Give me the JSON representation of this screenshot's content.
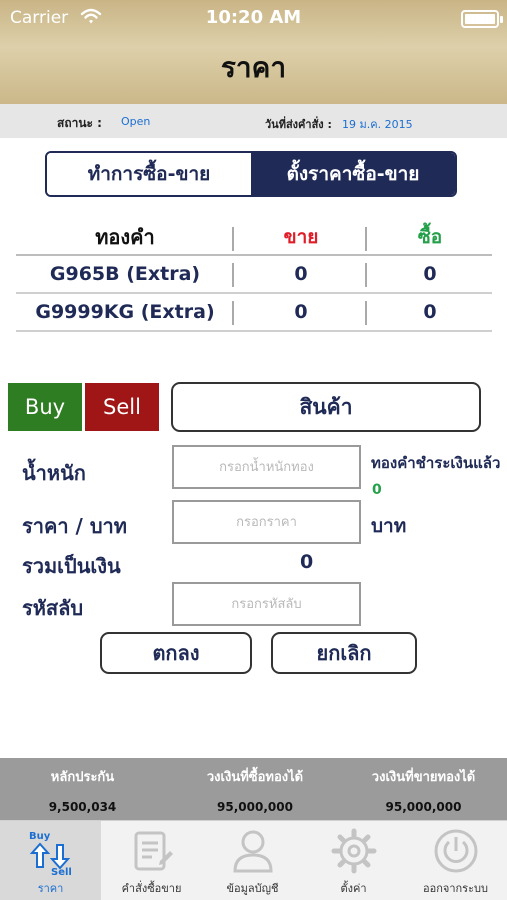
{
  "status_bar": {
    "carrier": "Carrier",
    "time": "10:20 AM"
  },
  "header": {
    "title": "ราคา"
  },
  "info": {
    "status_label": "สถานะ :",
    "status_value": "Open",
    "order_date_label": "วันที่ส่งคำสั่ง :",
    "order_date_value": "19 ม.ค. 2015"
  },
  "segment": {
    "trade_label": "ทำการซื้อ-ขาย",
    "set_price_label": "ตั้งราคาซื้อ-ขาย",
    "active": "set_price"
  },
  "price_table": {
    "headers": {
      "gold": "ทองคำ",
      "sell": "ขาย",
      "buy": "ซื้อ"
    },
    "rows": [
      {
        "product": "G965B (Extra)",
        "sell": "0",
        "buy": "0"
      },
      {
        "product": "G9999KG (Extra)",
        "sell": "0",
        "buy": "0"
      }
    ]
  },
  "order": {
    "buy_label": "Buy",
    "sell_label": "Sell",
    "product_button": "สินค้า",
    "weight_label": "น้ำหนัก",
    "weight_placeholder": "กรอกน้ำหนักทอง",
    "paid_gold_label": "ทองคำชำระเงินแล้ว",
    "paid_gold_value": "0",
    "price_label": "ราคา / บาท",
    "price_placeholder": "กรอกราคา",
    "price_unit": "บาท",
    "total_label": "รวมเป็นเงิน",
    "total_value": "0",
    "pin_label": "รหัสลับ",
    "pin_placeholder": "กรอกรหัสลับ",
    "ok_label": "ตกลง",
    "cancel_label": "ยกเลิก"
  },
  "summary": [
    {
      "label": "หลักประกัน",
      "value": "9,500,034"
    },
    {
      "label": "วงเงินที่ซื้อทองได้",
      "value": "95,000,000"
    },
    {
      "label": "วงเงินที่ขายทองได้",
      "value": "95,000,000"
    }
  ],
  "tabs": [
    {
      "label": "ราคา",
      "icon": "buy-sell-arrows-icon",
      "icon_text_top": "Buy",
      "icon_text_bottom": "Sell",
      "active": true
    },
    {
      "label": "คำสั่งซื้อขาย",
      "icon": "order-list-icon",
      "active": false
    },
    {
      "label": "ข้อมูลบัญชี",
      "icon": "account-person-icon",
      "active": false
    },
    {
      "label": "ตั้งค่า",
      "icon": "gear-icon",
      "active": false
    },
    {
      "label": "ออกจากระบบ",
      "icon": "power-icon",
      "active": false
    }
  ],
  "colors": {
    "header_gold": "#c9b486",
    "navy": "#1f2a56",
    "buy_green": "#2f7d22",
    "sell_red": "#a01515",
    "sell_header_red": "#e01e2a",
    "buy_header_green": "#25a04a",
    "link_blue": "#1c6fd1"
  }
}
